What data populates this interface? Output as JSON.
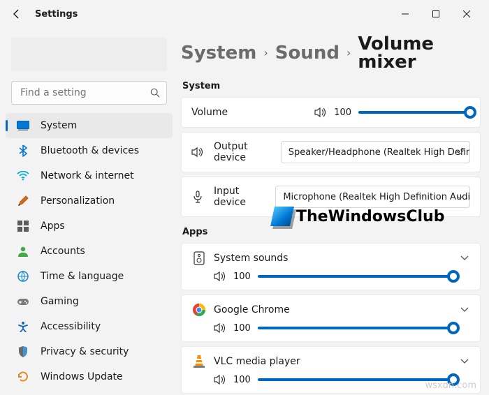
{
  "title": "Settings",
  "search": {
    "placeholder": "Find a setting"
  },
  "nav": [
    {
      "label": "System"
    },
    {
      "label": "Bluetooth & devices"
    },
    {
      "label": "Network & internet"
    },
    {
      "label": "Personalization"
    },
    {
      "label": "Apps"
    },
    {
      "label": "Accounts"
    },
    {
      "label": "Time & language"
    },
    {
      "label": "Gaming"
    },
    {
      "label": "Accessibility"
    },
    {
      "label": "Privacy & security"
    },
    {
      "label": "Windows Update"
    }
  ],
  "breadcrumb": {
    "a": "System",
    "b": "Sound",
    "c": "Volume mixer"
  },
  "systemSection": {
    "label": "System",
    "volume": {
      "label": "Volume",
      "value": "100"
    },
    "output": {
      "label": "Output device",
      "selected": "Speaker/Headphone (Realtek High Definitio"
    },
    "input": {
      "label": "Input device",
      "selected": "Microphone (Realtek High Definition Audio)"
    }
  },
  "appsSection": {
    "label": "Apps",
    "items": [
      {
        "name": "System sounds",
        "value": "100"
      },
      {
        "name": "Google Chrome",
        "value": "100"
      },
      {
        "name": "VLC media player",
        "value": "100"
      }
    ]
  },
  "watermark": "TheWindowsClub",
  "source": "wsxdn.com"
}
